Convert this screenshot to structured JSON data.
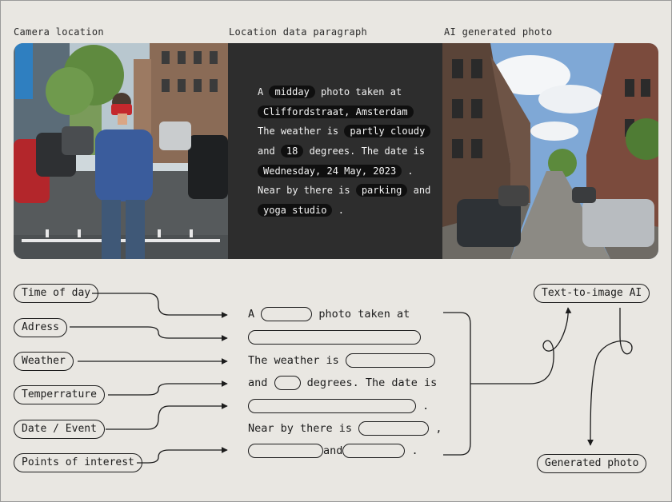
{
  "columns": {
    "camera": "Camera location",
    "paragraph": "Location data paragraph",
    "ai": "AI generated photo"
  },
  "paragraph": {
    "l1_pre": "A ",
    "time": "midday",
    "l1_post": " photo taken at",
    "address": "Cliffordstraat, Amsterdam",
    "l3_pre": "The weather is ",
    "weather": "partly cloudy",
    "l4_pre": "and ",
    "temp": "18",
    "l4_post": " degrees. The date is",
    "date": "Wednesday, 24 May, 2023",
    "l5_post": " .",
    "l6_pre": "Near by there is ",
    "poi1": "parking",
    "l6_post": " and",
    "poi2": "yoga studio",
    "l7_post": " ."
  },
  "inputs": [
    "Time of day",
    "Adress",
    "Weather",
    "Temperrature",
    "Date / Event",
    "Points of interest"
  ],
  "template": {
    "l1_pre": "A",
    "l1_post": "photo taken at",
    "l3_pre": "The weather is",
    "l4_pre": "and",
    "l4_post": "degrees. The date is",
    "l5_post": ".",
    "l6_pre": "Near by there is",
    "l6_post": ",",
    "l7_mid": "and",
    "l7_post": "."
  },
  "ai_node": "Text-to-image AI",
  "output_node": "Generated photo"
}
